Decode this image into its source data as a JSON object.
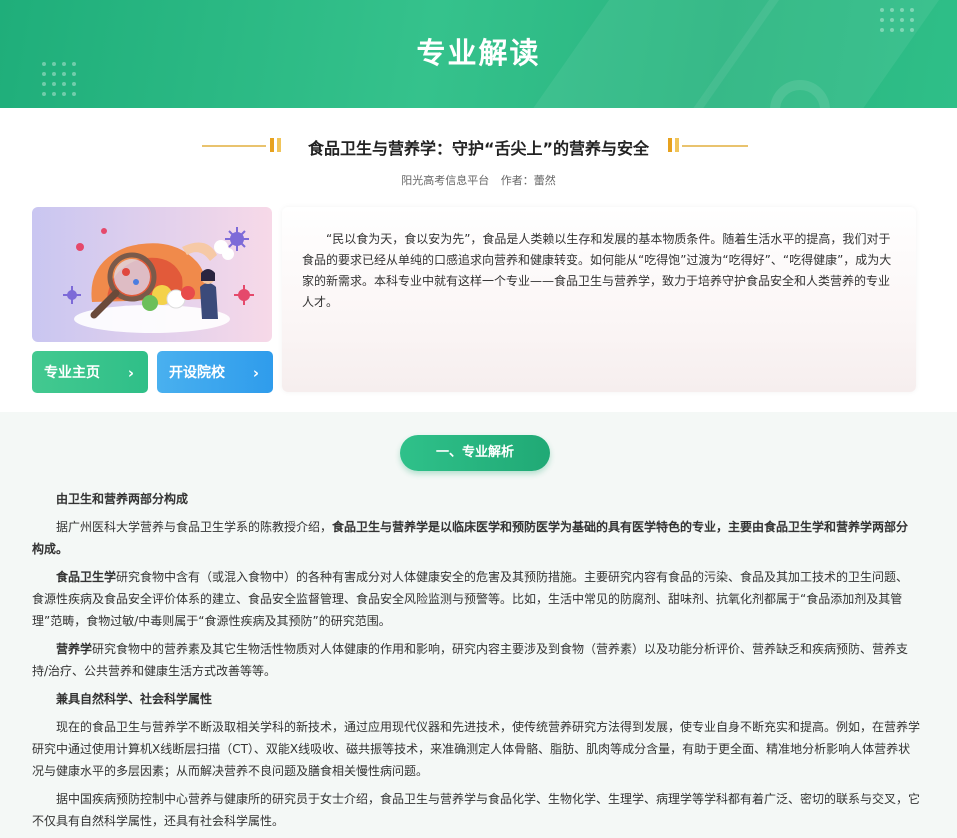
{
  "banner": {
    "title": "专业解读"
  },
  "article": {
    "title": "食品卫生与营养学：守护“舌尖上”的营养与安全",
    "source": "阳光高考信息平台",
    "author": "作者：蕾然"
  },
  "buttons": {
    "home_label": "专业主页",
    "schools_label": "开设院校"
  },
  "intro": {
    "text": "“民以食为天，食以安为先”，食品是人类赖以生存和发展的基本物质条件。随着生活水平的提高，我们对于食品的要求已经从单纯的口感追求向营养和健康转变。如何能从“吃得饱”过渡为“吃得好”、“吃得健康”，成为大家的新需求。本科专业中就有这样一个专业——食品卫生与营养学，致力于培养守护食品安全和人类营养的专业人才。"
  },
  "section1": {
    "heading": "一、专业解析",
    "sub1": "由卫生和营养两部分构成",
    "p1_prefix": "据广州医科大学营养与食品卫生学系的陈教授介绍，",
    "p1_bold": "食品卫生与营养学是以临床医学和预防医学为基础的具有医学特色的专业，主要由食品卫生学和营养学两部分构成。",
    "p2_bold": "食品卫生学",
    "p2_text": "研究食物中含有（或混入食物中）的各种有害成分对人体健康安全的危害及其预防措施。主要研究内容有食品的污染、食品及其加工技术的卫生问题、食源性疾病及食品安全评价体系的建立、食品安全监督管理、食品安全风险监测与预警等。比如，生活中常见的防腐剂、甜味剂、抗氧化剂都属于“食品添加剂及其管理”范畴，食物过敏/中毒则属于“食源性疾病及其预防”的研究范围。",
    "p3_bold": "营养学",
    "p3_text": "研究食物中的营养素及其它生物活性物质对人体健康的作用和影响，研究内容主要涉及到食物（营养素）以及功能分析评价、营养缺乏和疾病预防、营养支持/治疗、公共营养和健康生活方式改善等等。",
    "sub2": "兼具自然科学、社会科学属性",
    "p4": "现在的食品卫生与营养学不断汲取相关学科的新技术，通过应用现代仪器和先进技术，使传统营养研究方法得到发展，使专业自身不断充实和提高。例如，在营养学研究中通过使用计算机X线断层扫描（CT）、双能X线吸收、磁共振等技术，来准确测定人体骨骼、脂肪、肌肉等成分含量，有助于更全面、精准地分析影响人体营养状况与健康水平的多层因素；从而解决营养不良问题及膳食相关慢性病问题。",
    "p5": "据中国疾病预防控制中心营养与健康所的研究员于女士介绍，食品卫生与营养学与食品化学、生物化学、生理学、病理学等学科都有着广泛、密切的联系与交叉，它不仅具有自然科学属性，还具有社会科学属性。"
  },
  "colors": {
    "brand_green": "#2fbf88",
    "accent_blue": "#2f9cec",
    "deco_gold": "#e7a21f"
  }
}
